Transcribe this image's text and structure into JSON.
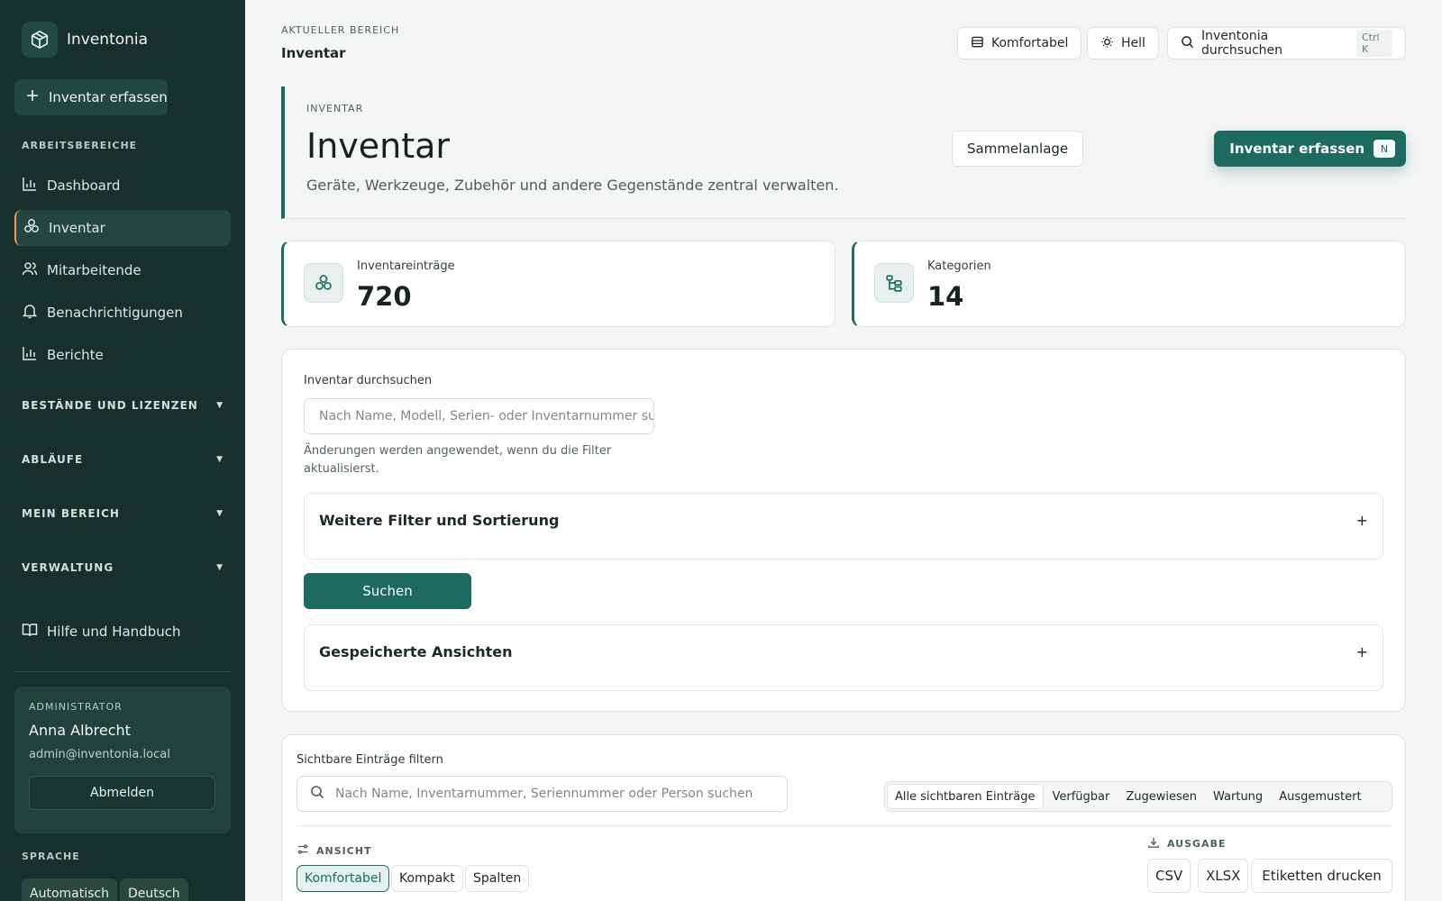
{
  "app": {
    "name": "Inventonia"
  },
  "sidebar": {
    "primary_action": "Inventar erfassen",
    "section_workspaces": "ARBEITSBEREICHE",
    "nav": [
      {
        "label": "Dashboard",
        "icon": "bar-chart-icon"
      },
      {
        "label": "Inventar",
        "icon": "boxes-icon",
        "active": true
      },
      {
        "label": "Mitarbeitende",
        "icon": "users-icon"
      },
      {
        "label": "Benachrichtigungen",
        "icon": "bell-icon"
      },
      {
        "label": "Berichte",
        "icon": "bar-chart-icon"
      }
    ],
    "groups": [
      "BESTÄNDE UND LIZENZEN",
      "ABLÄUFE",
      "MEIN BEREICH",
      "VERWALTUNG"
    ],
    "help": "Hilfe und Handbuch",
    "user": {
      "role": "ADMINISTRATOR",
      "name": "Anna Albrecht",
      "email": "admin@inventonia.local",
      "logout": "Abmelden"
    },
    "language": {
      "label": "SPRACHE",
      "options": [
        "Automatisch",
        "Deutsch"
      ]
    }
  },
  "topbar": {
    "crumb_label": "AKTUELLER BEREICH",
    "crumb_title": "Inventar",
    "density": "Komfortabel",
    "theme": "Hell",
    "search": "Inventonia durchsuchen",
    "shortcut": "Ctrl K"
  },
  "hero": {
    "label": "INVENTAR",
    "title": "Inventar",
    "subtitle": "Geräte, Werkzeuge, Zubehör und andere Gegenstände zentral verwalten.",
    "secondary_button": "Sammelanlage",
    "cta": "Inventar erfassen",
    "cta_key": "N"
  },
  "stats": [
    {
      "label": "Inventareinträge",
      "value": "720",
      "icon": "boxes-icon"
    },
    {
      "label": "Kategorien",
      "value": "14",
      "icon": "category-tree-icon"
    }
  ],
  "filter_panel": {
    "label": "Inventar durchsuchen",
    "placeholder": "Nach Name, Modell, Serien- oder Inventarnummer su",
    "hint": "Änderungen werden angewendet, wenn du die Filter aktualisierst.",
    "more_filters": "Weitere Filter und Sortierung",
    "search_button": "Suchen",
    "saved_views": "Gespeicherte Ansichten",
    "expand_symbol": "+"
  },
  "list_panel": {
    "label": "Sichtbare Einträge filtern",
    "placeholder": "Nach Name, Inventarnummer, Seriennummer oder Person suchen",
    "status_tabs": [
      "Alle sichtbaren Einträge",
      "Verfügbar",
      "Zugewiesen",
      "Wartung",
      "Ausgemustert"
    ],
    "view_label": "ANSICHT",
    "views": [
      "Komfortabel",
      "Kompakt",
      "Spalten"
    ],
    "output_label": "AUSGABE",
    "outputs": [
      "CSV",
      "XLSX",
      "Etiketten drucken"
    ]
  },
  "colors": {
    "sidebar_bg": "#17302b",
    "accent": "#1d6b60",
    "active_marker": "#e7a15a",
    "page_bg": "#f4f6f5"
  }
}
